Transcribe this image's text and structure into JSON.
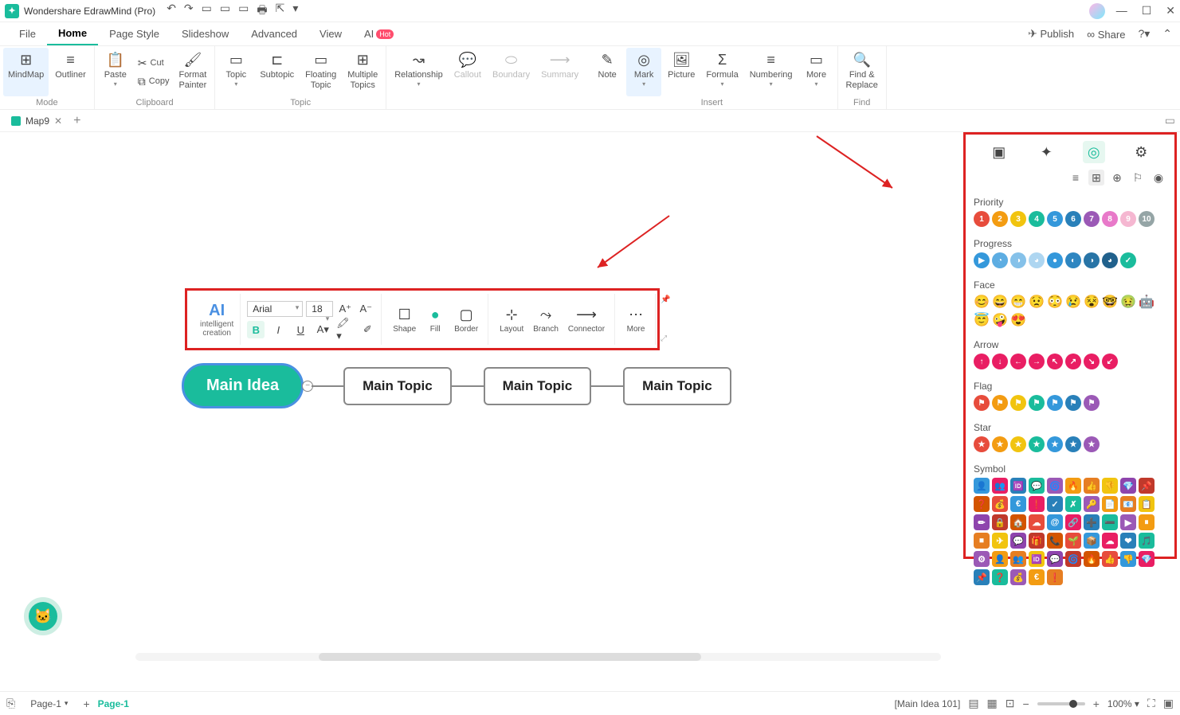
{
  "titlebar": {
    "app_name": "Wondershare EdrawMind (Pro)"
  },
  "menubar": {
    "tabs": [
      "File",
      "Home",
      "Page Style",
      "Slideshow",
      "Advanced",
      "View"
    ],
    "ai_label": "AI",
    "ai_badge": "Hot",
    "publish": "Publish",
    "share": "Share"
  },
  "ribbon": {
    "groups": {
      "mode": {
        "label": "Mode",
        "mindmap": "MindMap",
        "outliner": "Outliner"
      },
      "clipboard": {
        "label": "Clipboard",
        "paste": "Paste",
        "cut": "Cut",
        "copy": "Copy",
        "format_painter": "Format\nPainter"
      },
      "topic": {
        "label": "Topic",
        "topic": "Topic",
        "subtopic": "Subtopic",
        "floating": "Floating\nTopic",
        "multiple": "Multiple\nTopics"
      },
      "structure": {
        "relationship": "Relationship",
        "callout": "Callout",
        "boundary": "Boundary",
        "summary": "Summary"
      },
      "insert": {
        "label": "Insert",
        "note": "Note",
        "mark": "Mark",
        "picture": "Picture",
        "formula": "Formula",
        "numbering": "Numbering",
        "more": "More"
      },
      "find": {
        "label": "Find",
        "findreplace": "Find &\nReplace"
      }
    }
  },
  "tabstrip": {
    "tab1": "Map9"
  },
  "float_toolbar": {
    "ai": "intelligent\ncreation",
    "font_name": "Arial",
    "font_size": "18",
    "shape": "Shape",
    "fill": "Fill",
    "border": "Border",
    "layout": "Layout",
    "branch": "Branch",
    "connector": "Connector",
    "more": "More"
  },
  "nodes": {
    "main": "Main Idea",
    "t1": "Main Topic",
    "t2": "Main Topic",
    "t3": "Main Topic"
  },
  "right_panel": {
    "priority": "Priority",
    "progress": "Progress",
    "face": "Face",
    "arrow": "Arrow",
    "flag": "Flag",
    "star": "Star",
    "symbol": "Symbol"
  },
  "status": {
    "page_dd": "Page-1",
    "page_active": "Page-1",
    "selection": "[Main Idea 101]",
    "zoom": "100%"
  }
}
